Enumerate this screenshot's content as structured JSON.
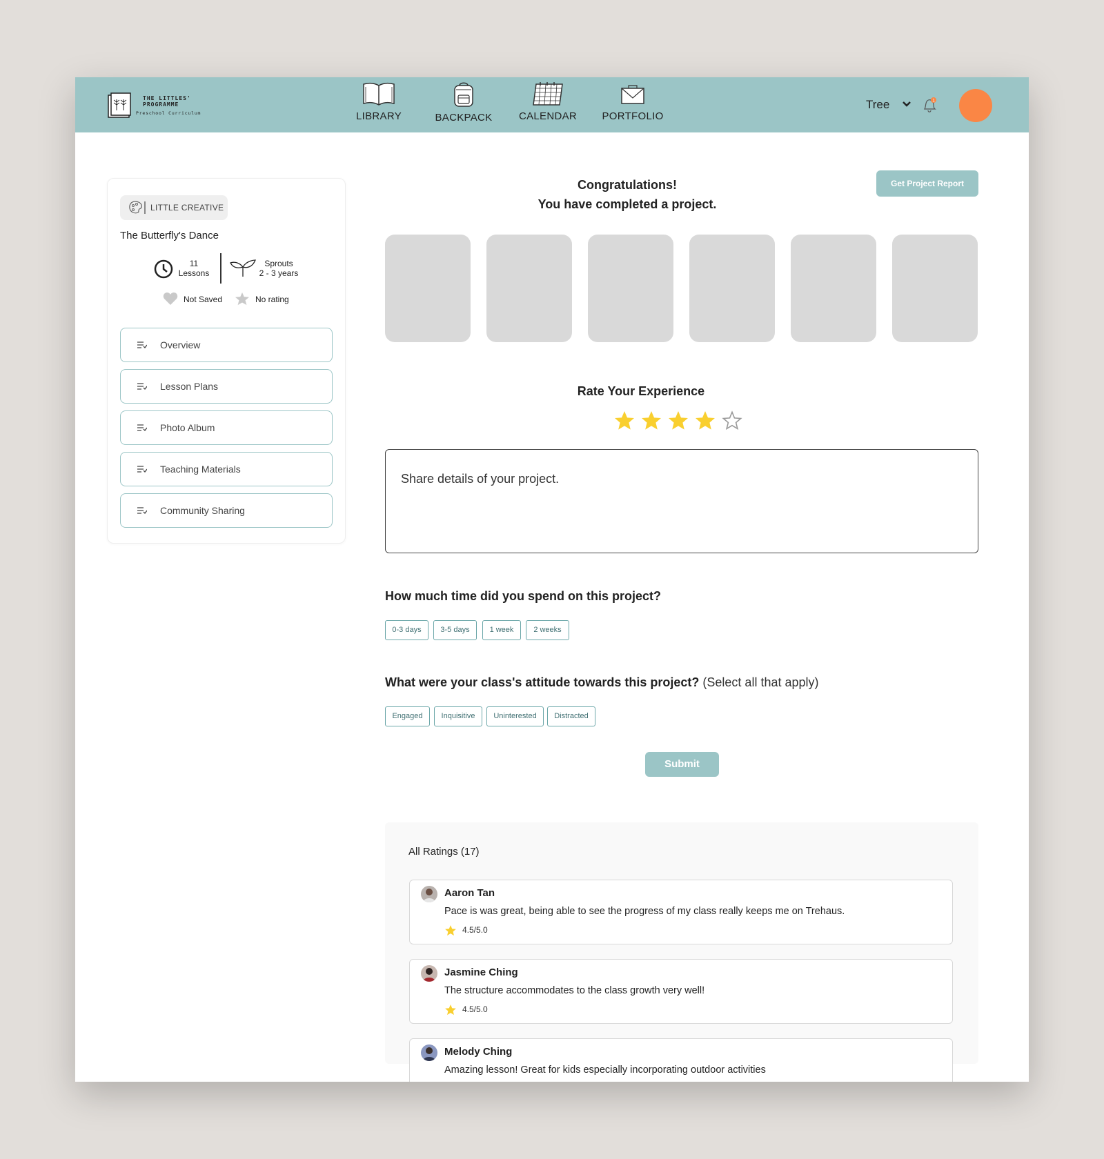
{
  "brand": {
    "title": "THE LITTLES'\nPROGRAMME",
    "subtitle": "Preschool Curriculum"
  },
  "nav": {
    "library": "LIBRARY",
    "backpack": "BACKPACK",
    "calendar": "CALENDAR",
    "portfolio": "PORTFOLIO"
  },
  "user": {
    "name": "Tree",
    "notification_count": "1",
    "avatar_color": "#fa8645"
  },
  "colors": {
    "accent": "#9bc5c6",
    "chip_border": "#6aa6a8",
    "star": "#f9cf2f",
    "placeholder": "#d9d9d9"
  },
  "sidebar": {
    "tag": "LITTLE CREATIVE",
    "project_title": "The Butterfly's Dance",
    "lessons_count": "11",
    "lessons_label": "Lessons",
    "age_group": "Sprouts",
    "age_range": "2 - 3 years",
    "saved_status": "Not Saved",
    "rating_status": "No rating",
    "items": [
      {
        "label": "Overview"
      },
      {
        "label": "Lesson Plans"
      },
      {
        "label": "Photo Album"
      },
      {
        "label": "Teaching Materials"
      },
      {
        "label": "Community Sharing"
      }
    ]
  },
  "main": {
    "congrats_line1": "Congratulations!",
    "congrats_line2": "You have completed a project.",
    "report_button": "Get Project Report",
    "photo_count": 6,
    "rate_title": "Rate Your Experience",
    "rating_value": 4,
    "rating_max": 5,
    "textarea_placeholder": "Share details of your project.",
    "time_question": "How much time did you spend on this project?",
    "time_options": [
      "0-3 days",
      "3-5 days",
      "1 week",
      "2 weeks"
    ],
    "attitude_question": "What were your class's attitude towards this project?",
    "attitude_hint": "(Select all that apply)",
    "attitude_options": [
      "Engaged",
      "Inquisitive",
      "Uninterested",
      "Distracted"
    ],
    "submit": "Submit"
  },
  "ratings": {
    "title": "All Ratings (17)",
    "reviews": [
      {
        "name": "Aaron Tan",
        "text": "Pace is was great, being able to see the progress of my class really keeps me on Trehaus.",
        "score": "4.5/5.0"
      },
      {
        "name": "Jasmine Ching",
        "text": "The structure accommodates to the class growth very well!",
        "score": "4.5/5.0"
      },
      {
        "name": "Melody Ching",
        "text": "Amazing lesson! Great for kids especially incorporating outdoor activities",
        "score": ""
      }
    ]
  }
}
